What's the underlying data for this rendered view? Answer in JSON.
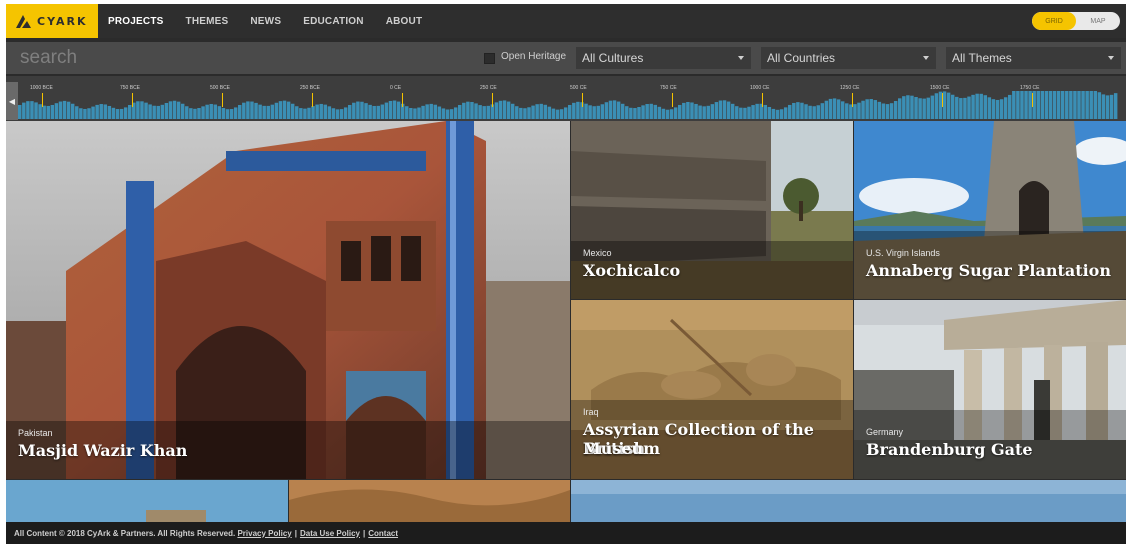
{
  "brand": {
    "name": "CYARK",
    "accent": "#f5c400"
  },
  "nav": {
    "items": [
      {
        "label": "PROJECTS",
        "active": true
      },
      {
        "label": "THEMES"
      },
      {
        "label": "NEWS"
      },
      {
        "label": "EDUCATION"
      },
      {
        "label": "ABOUT"
      }
    ],
    "view_toggle": {
      "grid": "GRID",
      "map": "MAP",
      "selected": "GRID"
    }
  },
  "filters": {
    "search_placeholder": "search",
    "open_heritage_label": "Open Heritage",
    "open_heritage_checked": false,
    "cultures": "All Cultures",
    "countries": "All Countries",
    "themes": "All Themes"
  },
  "timeline": {
    "ticks": [
      "1000 BCE",
      "750 BCE",
      "500 BCE",
      "250 BCE",
      "0 CE",
      "250 CE",
      "500 CE",
      "750 CE",
      "1000 CE",
      "1250 CE",
      "1500 CE",
      "1750 CE"
    ],
    "bar_color": "#3b8fb5",
    "marker_color": "#f5c400"
  },
  "projects": [
    {
      "country": "Pakistan",
      "title": "Masjid Wazir Khan"
    },
    {
      "country": "Mexico",
      "title": "Xochicalco"
    },
    {
      "country": "U.S. Virgin Islands",
      "title": "Annaberg Sugar Plantation"
    },
    {
      "country": "Iraq",
      "title_line1": "Assyrian Collection of the British",
      "title_line2": "Museum"
    },
    {
      "country": "Germany",
      "title": "Brandenburg Gate"
    }
  ],
  "footer": {
    "copyright": "All Content © 2018 CyArk & Partners. All Rights Reserved.",
    "privacy": "Privacy Policy",
    "data_use": "Data Use Policy",
    "contact": "Contact",
    "separator": "|"
  }
}
